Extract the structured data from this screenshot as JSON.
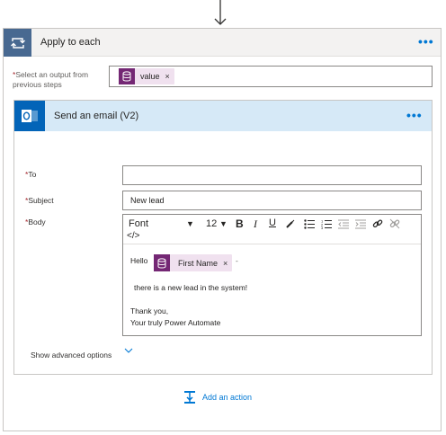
{
  "apply_each": {
    "title": "Apply to each",
    "more": "•••",
    "select_label_req": "*",
    "select_label": "Select an output from previous steps",
    "token": {
      "label": "value",
      "remove": "×"
    }
  },
  "email": {
    "title": "Send an email (V2)",
    "more": "•••",
    "fields": {
      "to_label": "To",
      "to_value": "",
      "subject_label": "Subject",
      "subject_value": "New lead",
      "body_label": "Body",
      "required_mark": "*"
    },
    "toolbar": {
      "font": "Font",
      "font_caret": "▼",
      "size": "12",
      "size_caret": "▼",
      "bold": "B",
      "italic": "I",
      "underline": "U",
      "code_view": "</>"
    },
    "body": {
      "greeting": "Hello",
      "token": {
        "label": "First Name",
        "remove": "×"
      },
      "trailing": "-",
      "line1": "there is a new lead in the system!",
      "line2": "Thank you,",
      "line3": "Your truly Power Automate"
    },
    "advanced": "Show advanced options"
  },
  "add_action": "Add an action",
  "colors": {
    "loop_tile": "#486991",
    "outlook_tile": "#0364b8",
    "token_icon": "#742774",
    "token_bg": "#f0e1ef",
    "accent": "#0078d4",
    "header_blue": "#d6e9f7"
  }
}
